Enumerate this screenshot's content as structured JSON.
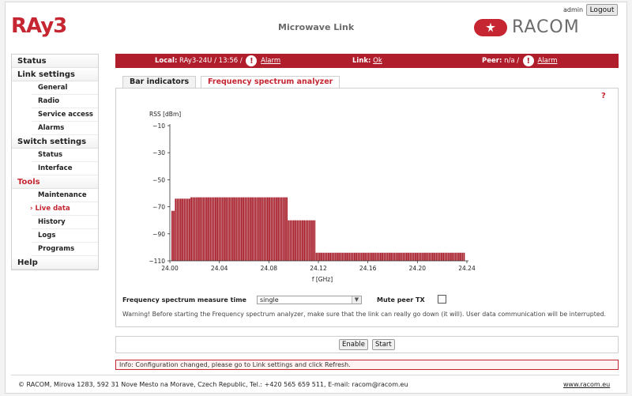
{
  "header": {
    "logo_text": "RAy3",
    "title": "Microwave Link",
    "username": "admin",
    "logout_label": "Logout",
    "brand_text": "RACOM"
  },
  "sidebar": {
    "sections": [
      {
        "label": "Status",
        "items": []
      },
      {
        "label": "Link settings",
        "items": [
          "General",
          "Radio",
          "Service access",
          "Alarms"
        ]
      },
      {
        "label": "Switch settings",
        "items": [
          "Status",
          "Interface"
        ]
      },
      {
        "label": "Tools",
        "items": [
          "Maintenance",
          "Live data",
          "History",
          "Logs",
          "Programs"
        ]
      },
      {
        "label": "Help",
        "items": []
      }
    ],
    "active_section": "Tools",
    "active_item": "Live data"
  },
  "statusbar": {
    "local_label": "Local:",
    "local_value": "RAy3-24U / 13:56 /",
    "local_alarm": "Alarm",
    "link_label": "Link:",
    "link_value": "Ok",
    "peer_label": "Peer:",
    "peer_value": "n/a /",
    "peer_alarm": "Alarm",
    "alert_icon": "exclamation-circle-icon",
    "bar_color": "#b01e2c"
  },
  "tabs": [
    {
      "label": "Bar indicators",
      "active": false
    },
    {
      "label": "Frequency spectrum analyzer",
      "active": true
    }
  ],
  "help_label": "?",
  "chart_data": {
    "type": "bar",
    "title": "",
    "ylabel": "RSS [dBm]",
    "xlabel": "f [GHz]",
    "ylim": [
      -110,
      -10
    ],
    "xlim": [
      24.0,
      24.24
    ],
    "yticks": [
      -10,
      -30,
      -50,
      -70,
      -90,
      -110
    ],
    "xticks": [
      "24.00",
      "24.04",
      "24.08",
      "24.12",
      "24.16",
      "24.20",
      "24.24"
    ],
    "bar_color": "#a8202c",
    "grid": false,
    "segments": [
      {
        "f_start": 24.0,
        "f_end": 24.003,
        "rss": -73
      },
      {
        "f_start": 24.003,
        "f_end": 24.016,
        "rss": -64
      },
      {
        "f_start": 24.016,
        "f_end": 24.094,
        "rss": -63
      },
      {
        "f_start": 24.094,
        "f_end": 24.117,
        "rss": -80
      },
      {
        "f_start": 24.117,
        "f_end": 24.24,
        "rss": -104
      }
    ]
  },
  "controls": {
    "measure_time_label": "Frequency spectrum measure time",
    "measure_time_value": "single",
    "mute_label": "Mute peer TX",
    "mute_checked": false,
    "warning": "Warning! Before starting the Frequency spectrum analyzer, make sure that the link can really go down (it will). User data communication will be interrupted."
  },
  "buttons": {
    "enable_label": "Enable",
    "start_label": "Start"
  },
  "info_message": "Info: Configuration changed, please go to Link settings and click Refresh.",
  "footer": {
    "text": "© RACOM, Mirova 1283, 592 31 Nove Mesto na Morave, Czech Republic, Tel.: +420 565 659 511, E-mail: racom@racom.eu",
    "link": "www.racom.eu"
  }
}
